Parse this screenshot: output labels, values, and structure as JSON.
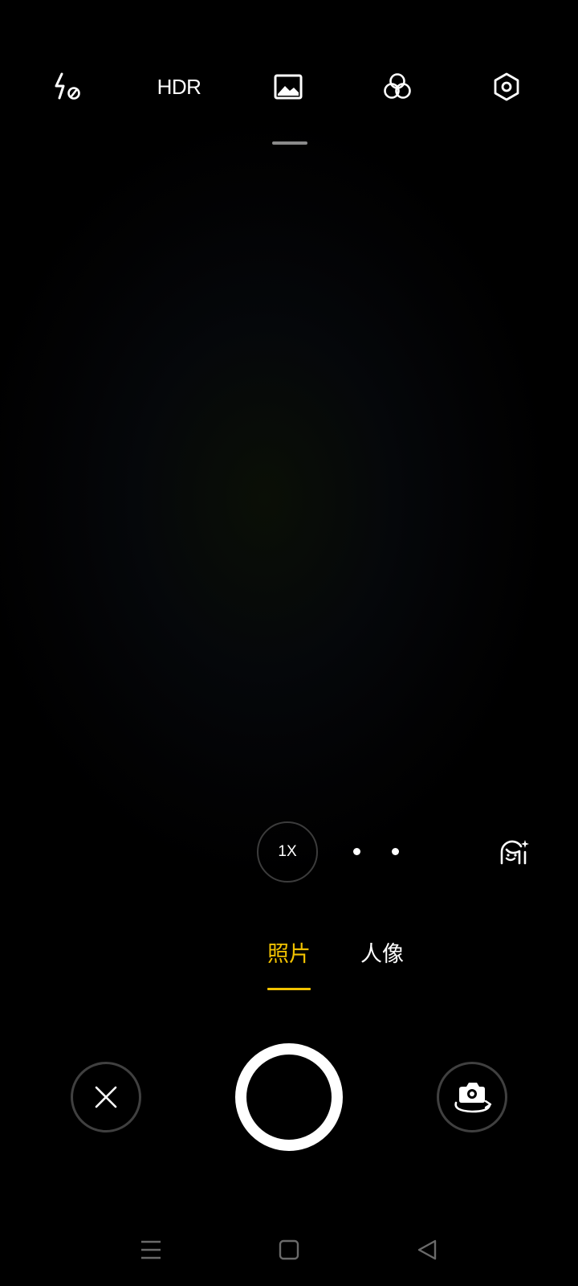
{
  "top_bar": {
    "flash_icon": "flash-off-icon",
    "hdr_label": "HDR",
    "aspect_icon": "image-frame-icon",
    "filter_icon": "filter-circles-icon",
    "settings_icon": "settings-hexagon-icon"
  },
  "zoom": {
    "current": "1X",
    "extra_levels_icon": "dot-icon"
  },
  "beauty_icon": "face-beauty-icon",
  "modes": {
    "items": [
      {
        "label": "照片",
        "active": true
      },
      {
        "label": "人像",
        "active": false
      }
    ]
  },
  "controls": {
    "close_icon": "close-x-icon",
    "shutter_icon": "shutter-ring-icon",
    "switch_camera_icon": "camera-flip-icon"
  },
  "nav": {
    "menu_icon": "menu-lines-icon",
    "home_icon": "home-square-icon",
    "back_icon": "back-triangle-icon"
  },
  "colors": {
    "accent": "#f2c200",
    "background": "#000000",
    "foreground": "#ffffff",
    "ring_border": "#404040"
  }
}
